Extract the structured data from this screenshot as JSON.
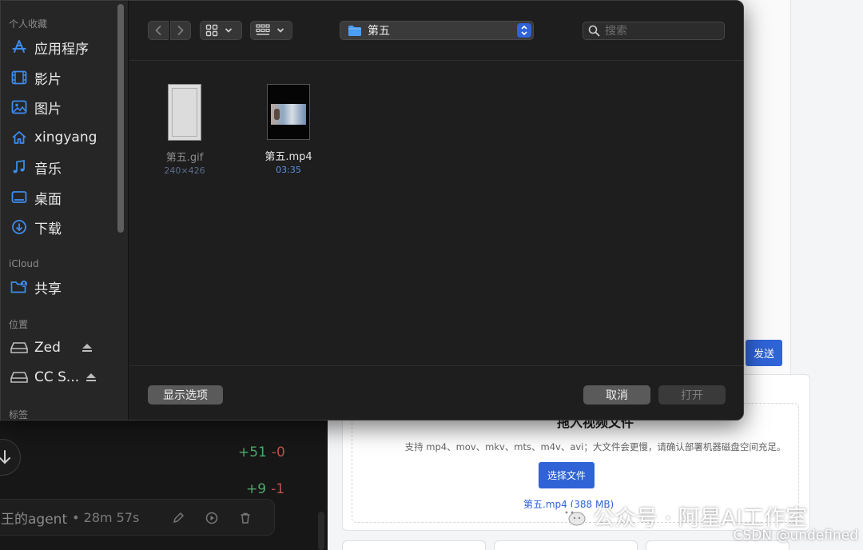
{
  "background_left": {
    "diff_1": {
      "add": "+51",
      "del": "-0"
    },
    "diff_2": {
      "add": "+9",
      "del": "-1"
    },
    "task": {
      "title": "王的agent",
      "time": "• 28m 57s"
    }
  },
  "background_right": {
    "send_label": "发送",
    "upload_title": "拖入视频文件",
    "upload_hint": "支持 mp4、mov、mkv、mts、m4v、avi；大文件会更慢，请确认部署机器磁盘空间充足。",
    "choose_label": "选择文件",
    "file_note": "第五.mp4 (388 MB)"
  },
  "dialog": {
    "sidebar": {
      "sections": {
        "favorites": "个人收藏",
        "icloud": "iCloud",
        "locations": "位置",
        "tags": "标签"
      },
      "favorites": [
        {
          "label": "应用程序",
          "icon": "applications-icon"
        },
        {
          "label": "影片",
          "icon": "movies-icon"
        },
        {
          "label": "图片",
          "icon": "pictures-icon"
        },
        {
          "label": "xingyang",
          "icon": "home-icon"
        },
        {
          "label": "音乐",
          "icon": "music-icon"
        },
        {
          "label": "桌面",
          "icon": "desktop-icon"
        },
        {
          "label": "下载",
          "icon": "downloads-icon"
        }
      ],
      "icloud": [
        {
          "label": "共享",
          "icon": "shared-folder-icon"
        }
      ],
      "locations": [
        {
          "label": "Zed",
          "icon": "drive-icon"
        },
        {
          "label": "CC S...",
          "icon": "drive-icon"
        }
      ]
    },
    "toolbar": {
      "path": "第五",
      "search_placeholder": "搜索"
    },
    "files": [
      {
        "name": "第五.gif",
        "meta": "240×426",
        "enabled": false
      },
      {
        "name": "第五.mp4",
        "meta": "03:35",
        "enabled": true
      }
    ],
    "footer": {
      "options_label": "显示选项",
      "cancel_label": "取消",
      "open_label": "打开"
    }
  },
  "watermark": {
    "text": "公众号 · 阿星AI工作室",
    "csdn": "CSDN @undefined"
  },
  "colors": {
    "accent": "#2f63d6",
    "sidebar_icon": "#3b8cf0",
    "diff_add": "#4fa86a",
    "diff_del": "#c0504d"
  }
}
